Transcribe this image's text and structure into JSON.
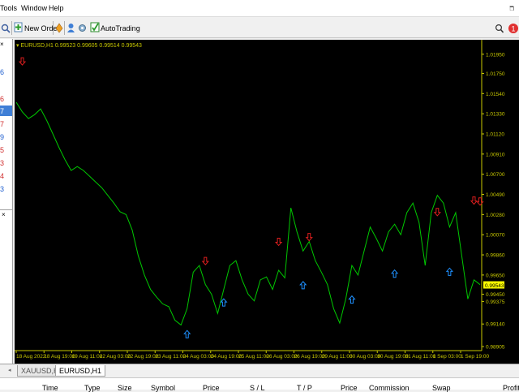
{
  "menu": {
    "items": [
      "Tools",
      "Window",
      "Help"
    ]
  },
  "toolbar": {
    "new_order": "New Order",
    "auto_trading": "AutoTrading"
  },
  "left_panel": {
    "numbers": [
      "6",
      "7",
      "6",
      "7",
      "9",
      "5",
      "3",
      "4",
      "3"
    ]
  },
  "chart": {
    "symbol_header": "EURUSD,H1",
    "ohlc": "0.99523 0.99605 0.99514 0.99543",
    "current_price": "0.99543",
    "colors": {
      "background": "#000000",
      "line": "#00c800",
      "axis": "#c8c800",
      "buy_arrow": "#1e90ff",
      "sell_arrow": "#dc1e1e",
      "price_label_bg": "#ffff00"
    }
  },
  "tabs": [
    {
      "label": "XAUUSD,H1"
    },
    {
      "label": "EURUSD,H1"
    }
  ],
  "terminal": {
    "columns": [
      "Time",
      "Type",
      "Size",
      "Symbol",
      "Price",
      "S / L",
      "T / P",
      "Price",
      "Commission",
      "Swap",
      "Profit"
    ]
  },
  "chart_data": {
    "type": "line",
    "series": [
      {
        "values": [
          1.0145,
          1.0135,
          1.0128,
          1.0132,
          1.0138,
          1.0126,
          1.0112,
          1.0098,
          1.0085,
          1.0074,
          1.0078,
          1.0074,
          1.0068,
          1.0062,
          1.0056,
          1.0048,
          1.004,
          1.0031,
          1.0028,
          1.0012,
          0.9985,
          0.9965,
          0.995,
          0.9942,
          0.9935,
          0.9932,
          0.9918,
          0.9913,
          0.993,
          0.9968,
          0.9975,
          0.9955,
          0.9945,
          0.9925,
          0.995,
          0.9975,
          0.998,
          0.996,
          0.9945,
          0.9938,
          0.996,
          0.9963,
          0.995,
          0.997,
          0.9962,
          1.0035,
          1.001,
          0.999,
          1.0,
          0.998,
          0.9968,
          0.9955,
          0.993,
          0.9915,
          0.994,
          0.9975,
          0.9965,
          0.999,
          1.0015,
          1.0003,
          0.999,
          1.001,
          1.0018,
          1.0007,
          1.003,
          1.004,
          1.002,
          0.9975,
          1.003,
          1.0048,
          1.004,
          1.0015,
          1.003,
          0.9985,
          0.994,
          0.996,
          0.9955
        ]
      }
    ],
    "y_ticks": [
      "1.01950",
      "1.01750",
      "1.01540",
      "1.01330",
      "1.01120",
      "1.00910",
      "1.00700",
      "1.00490",
      "1.00280",
      "1.00070",
      "0.99860",
      "0.99650",
      "0.99450",
      "0.99375",
      "0.99140",
      "0.98905"
    ],
    "x_ticks": [
      "18 Aug 2022",
      "18 Aug 19:00",
      "19 Aug 11:00",
      "22 Aug 03:00",
      "22 Aug 19:00",
      "23 Aug 11:00",
      "24 Aug 03:00",
      "24 Aug 19:00",
      "25 Aug 11:00",
      "26 Aug 03:00",
      "26 Aug 19:00",
      "29 Aug 11:00",
      "30 Aug 03:00",
      "30 Aug 19:00",
      "31 Aug 11:00",
      "1 Sep 03:00",
      "1 Sep 19:00"
    ],
    "ylim": [
      0.98905,
      1.0205
    ],
    "buy_arrows": [
      [
        28,
        0.9903
      ],
      [
        34,
        0.9936
      ],
      [
        47,
        0.9954
      ],
      [
        55,
        0.9939
      ],
      [
        62,
        0.9966
      ],
      [
        71,
        0.9968
      ]
    ],
    "sell_arrows": [
      [
        1,
        1.0188
      ],
      [
        31,
        0.998
      ],
      [
        43,
        1.0
      ],
      [
        48,
        1.0005
      ],
      [
        69,
        1.0031
      ],
      [
        75,
        1.0043
      ],
      [
        78,
        1.0042
      ]
    ]
  }
}
